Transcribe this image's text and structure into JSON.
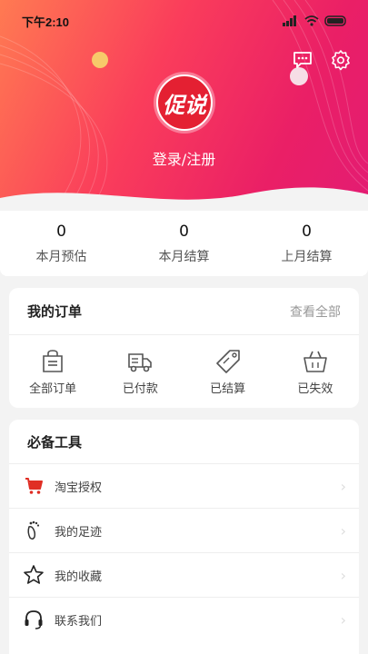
{
  "status_bar": {
    "time": "下午2:10"
  },
  "profile": {
    "logo_text": "促说",
    "login_label": "登录/注册"
  },
  "stats": [
    {
      "value": "0",
      "label": "本月预估"
    },
    {
      "value": "0",
      "label": "本月结算"
    },
    {
      "value": "0",
      "label": "上月结算"
    }
  ],
  "orders": {
    "title": "我的订单",
    "view_all": "查看全部",
    "items": [
      {
        "label": "全部订单",
        "icon": "shopping-bag-icon"
      },
      {
        "label": "已付款",
        "icon": "delivery-truck-icon"
      },
      {
        "label": "已结算",
        "icon": "price-tag-icon"
      },
      {
        "label": "已失效",
        "icon": "basket-icon"
      }
    ]
  },
  "tools": {
    "title": "必备工具",
    "items": [
      {
        "label": "淘宝授权",
        "icon": "shopping-cart-icon"
      },
      {
        "label": "我的足迹",
        "icon": "footprint-icon"
      },
      {
        "label": "我的收藏",
        "icon": "star-icon"
      },
      {
        "label": "联系我们",
        "icon": "headset-icon"
      }
    ]
  },
  "colors": {
    "hero_start": "#ff7a52",
    "hero_end": "#e31c73",
    "cart_red": "#e02e24"
  }
}
